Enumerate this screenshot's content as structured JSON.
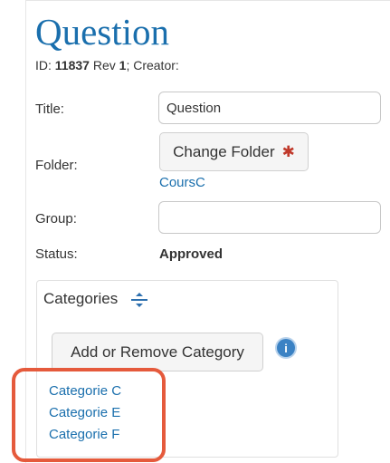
{
  "page": {
    "title": "Question"
  },
  "meta": {
    "id_label": "ID:",
    "id_value": "11837",
    "rev_label": "Rev",
    "rev_value": "1",
    "creator_label": "; Creator:"
  },
  "form": {
    "title_label": "Title:",
    "title_value": "Question",
    "folder_label": "Folder:",
    "change_folder_label": "Change Folder",
    "required_mark": "✱",
    "folder_link": "CoursC",
    "group_label": "Group:",
    "group_value": "",
    "status_label": "Status:",
    "status_value": "Approved"
  },
  "categories": {
    "title": "Categories",
    "add_remove_label": "Add or Remove Category",
    "info_icon": "i",
    "items": [
      "Categorie C",
      "Categorie E",
      "Categorie F"
    ]
  },
  "colors": {
    "accent": "#1a6fad",
    "highlight": "#e55a3c",
    "required": "#c0392b"
  }
}
